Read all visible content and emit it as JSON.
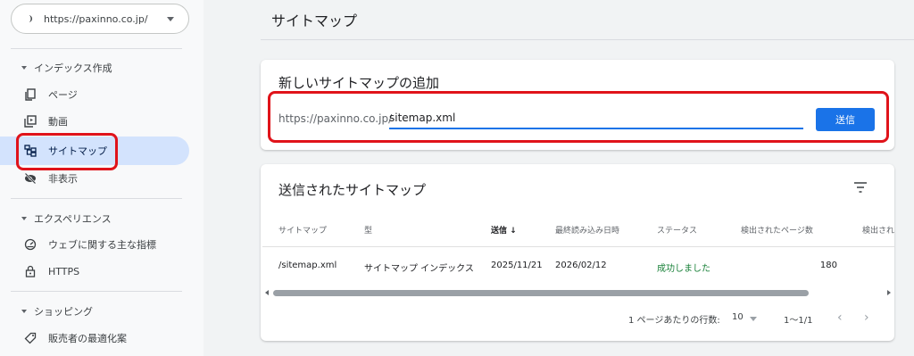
{
  "property": {
    "url": "https://paxinno.co.jp/"
  },
  "sidebar": {
    "sections": [
      {
        "title": "インデックス作成"
      },
      {
        "title": "エクスペリエンス"
      },
      {
        "title": "ショッピング"
      }
    ],
    "items": [
      {
        "label": "ページ",
        "icon": "pages-icon"
      },
      {
        "label": "動画",
        "icon": "video-icon"
      },
      {
        "label": "サイトマップ",
        "icon": "sitemap-icon",
        "active": true
      },
      {
        "label": "非表示",
        "icon": "hidden-icon"
      },
      {
        "label": "ウェブに関する主な指標",
        "icon": "gauge-icon"
      },
      {
        "label": "HTTPS",
        "icon": "lock-icon"
      },
      {
        "label": "販売者の最適化案",
        "icon": "tag-icon"
      }
    ]
  },
  "main": {
    "title": "サイトマップ"
  },
  "add_card": {
    "title": "新しいサイトマップの追加",
    "prefix": "https://paxinno.co.jp/",
    "input_value": "sitemap.xml",
    "submit_label": "送信"
  },
  "submitted_card": {
    "title": "送信されたサイトマップ",
    "columns": [
      "サイトマップ",
      "型",
      "送信 ↓",
      "最終読み込み日時",
      "ステータス",
      "検出されたページ数",
      "検出され"
    ],
    "rows": [
      [
        "/sitemap.xml",
        "サイトマップ インデックス",
        "2025/11/21",
        "2026/02/12",
        "成功しました",
        "180"
      ]
    ],
    "pagination": {
      "rows_per_page_label": "1 ページあたりの行数:",
      "rows_per_page": "10",
      "range": "1〜1/1"
    }
  },
  "colors": {
    "accent": "#1a73e8",
    "highlight": "#e0131a",
    "success": "#188038",
    "active_nav": "#d3e3fd"
  }
}
